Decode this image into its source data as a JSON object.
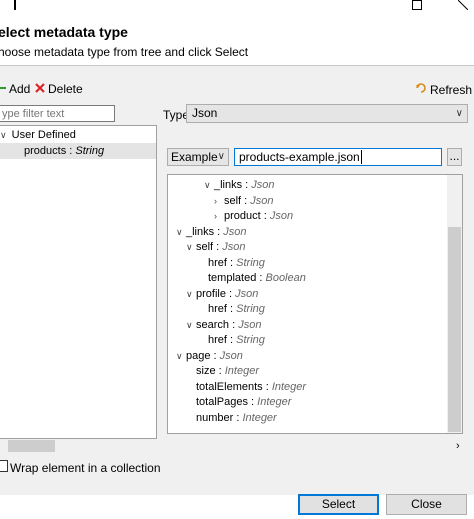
{
  "window": {
    "title": "elect metadata type",
    "subtitle": "hoose metadata type from tree and click Select",
    "title_bar_icons": [
      "maximize-icon",
      "restore-icon"
    ]
  },
  "toolbar": {
    "add_label": "Add",
    "delete_label": "Delete",
    "refresh_label": "Refresh"
  },
  "filter": {
    "placeholder": "ype filter text"
  },
  "left_tree": {
    "items": [
      {
        "label": "User Defined",
        "expanded": true
      },
      {
        "name": "products",
        "type": "String",
        "selected": true
      }
    ]
  },
  "type_selector": {
    "label": "Type",
    "value": "Json"
  },
  "example": {
    "mode": "Example",
    "file": "products-example.json",
    "browse_label": "..."
  },
  "json_tree": {
    "nodes": [
      {
        "name": "_links",
        "type": "Json",
        "arrow": "v"
      },
      {
        "name": "self",
        "type": "Json",
        "arrow": ">"
      },
      {
        "name": "product",
        "type": "Json",
        "arrow": ">"
      },
      {
        "name": "_links",
        "type": "Json",
        "arrow": "v"
      },
      {
        "name": "self",
        "type": "Json",
        "arrow": "v"
      },
      {
        "name": "href",
        "type": "String",
        "arrow": ""
      },
      {
        "name": "templated",
        "type": "Boolean",
        "arrow": ""
      },
      {
        "name": "profile",
        "type": "Json",
        "arrow": "v"
      },
      {
        "name": "href",
        "type": "String",
        "arrow": ""
      },
      {
        "name": "search",
        "type": "Json",
        "arrow": "v"
      },
      {
        "name": "href",
        "type": "String",
        "arrow": ""
      },
      {
        "name": "page",
        "type": "Json",
        "arrow": "v"
      },
      {
        "name": "size",
        "type": "Integer",
        "arrow": ""
      },
      {
        "name": "totalElements",
        "type": "Integer",
        "arrow": ""
      },
      {
        "name": "totalPages",
        "type": "Integer",
        "arrow": ""
      },
      {
        "name": "number",
        "type": "Integer",
        "arrow": ""
      }
    ]
  },
  "wrap": {
    "label": "Wrap element in a collection",
    "checked": false
  },
  "buttons": {
    "select": "Select",
    "close": "Close"
  },
  "colors": {
    "accent": "#0078d7",
    "delete_red": "#d9262a",
    "refresh_orange": "#d98c1a"
  }
}
